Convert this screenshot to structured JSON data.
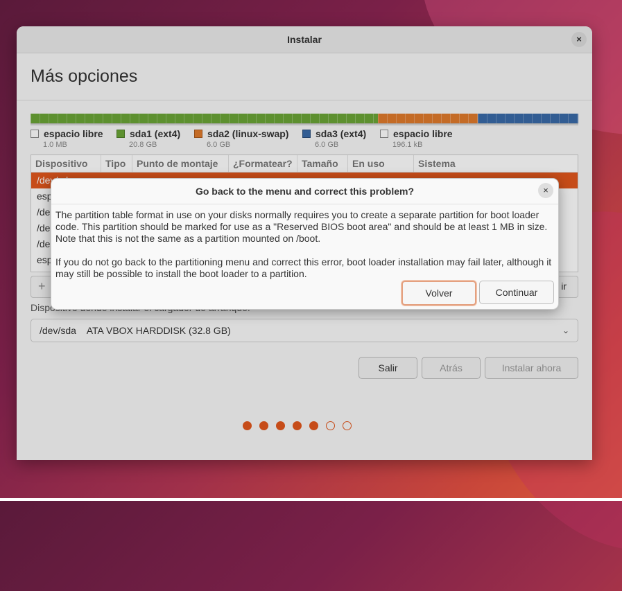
{
  "window": {
    "title": "Instalar",
    "close_icon": "×"
  },
  "page": {
    "title": "Más opciones"
  },
  "disk_bar": {
    "segments": [
      {
        "label": "espacio libre",
        "size": "1.0 MB",
        "color": "#ffffff",
        "fraction": 0.0
      },
      {
        "label": "sda1 (ext4)",
        "size": "20.8 GB",
        "color": "#6aa436",
        "fraction": 0.634
      },
      {
        "label": "sda2 (linux-swap)",
        "size": "6.0 GB",
        "color": "#e07a2c",
        "fraction": 0.183
      },
      {
        "label": "sda3 (ext4)",
        "size": "6.0 GB",
        "color": "#3a6aa8",
        "fraction": 0.183
      },
      {
        "label": "espacio libre",
        "size": "196.1 kB",
        "color": "#ffffff",
        "fraction": 0.0
      }
    ]
  },
  "table": {
    "headers": [
      "Dispositivo",
      "Tipo",
      "Punto de montaje",
      "¿Formatear?",
      "Tamaño",
      "En uso",
      "Sistema"
    ],
    "rows": [
      "/dev/sda",
      "esp",
      "/de",
      "/de",
      "/de",
      "esp"
    ],
    "add_icon": "+",
    "right_button_fragment": "ir"
  },
  "bootloader": {
    "label": "Dispositivo donde instalar el cargador de arranque:",
    "value": "/dev/sda    ATA VBOX HARDDISK (32.8 GB)",
    "chevron": "⌄"
  },
  "buttons": {
    "quit": "Salir",
    "back": "Atrás",
    "install": "Instalar ahora"
  },
  "progress": {
    "total_steps": 7,
    "completed_steps": 5
  },
  "dialog": {
    "title": "Go back to the menu and correct this problem?",
    "close_icon": "×",
    "paragraph1": "The partition table format in use on your disks normally requires you to create a separate partition for boot loader code. This partition should be marked for use as a \"Reserved BIOS boot area\" and should be at least 1 MB in size. Note that this is not the same as a partition mounted on /boot.",
    "paragraph2": "If you do not go back to the partitioning menu and correct this error, boot loader installation may fail later, although it may still be possible to install the boot loader to a partition.",
    "go_back": "Volver",
    "continue": "Continuar"
  },
  "colors": {
    "accent": "#e2571d"
  }
}
